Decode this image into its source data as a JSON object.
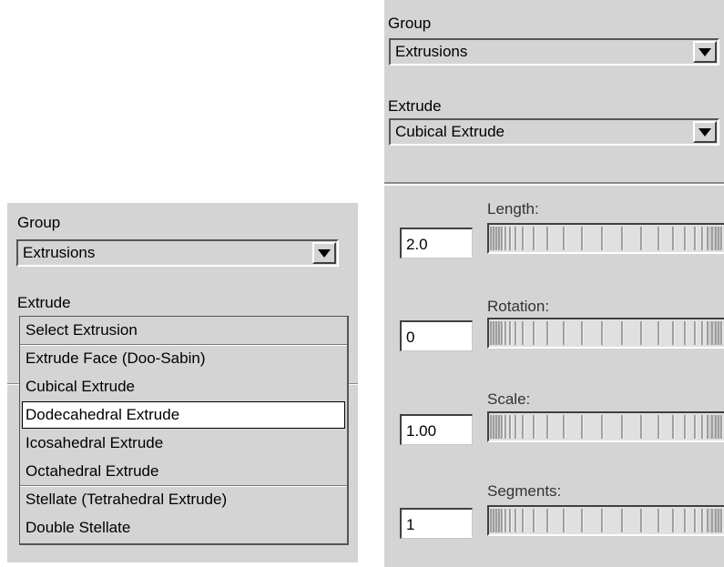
{
  "left_panel": {
    "group_label": "Group",
    "group_value": "Extrusions",
    "extrude_label": "Extrude",
    "dropdown_options": [
      "Select Extrusion",
      "Extrude Face (Doo-Sabin)",
      "Cubical Extrude",
      "Dodecahedral Extrude",
      "Icosahedral Extrude",
      "Octahedral Extrude",
      "Stellate (Tetrahedral Extrude)",
      "Double Stellate"
    ],
    "selected_option": "Dodecahedral Extrude"
  },
  "right_panel": {
    "group_label": "Group",
    "group_value": "Extrusions",
    "extrude_label": "Extrude",
    "extrude_value": "Cubical Extrude",
    "params": [
      {
        "label": "Length:",
        "value": "2.0"
      },
      {
        "label": "Rotation:",
        "value": "0"
      },
      {
        "label": "Scale:",
        "value": "1.00"
      },
      {
        "label": "Segments:",
        "value": "1"
      }
    ]
  },
  "icons": {
    "dropdown_arrow": "triangle-down-icon"
  }
}
